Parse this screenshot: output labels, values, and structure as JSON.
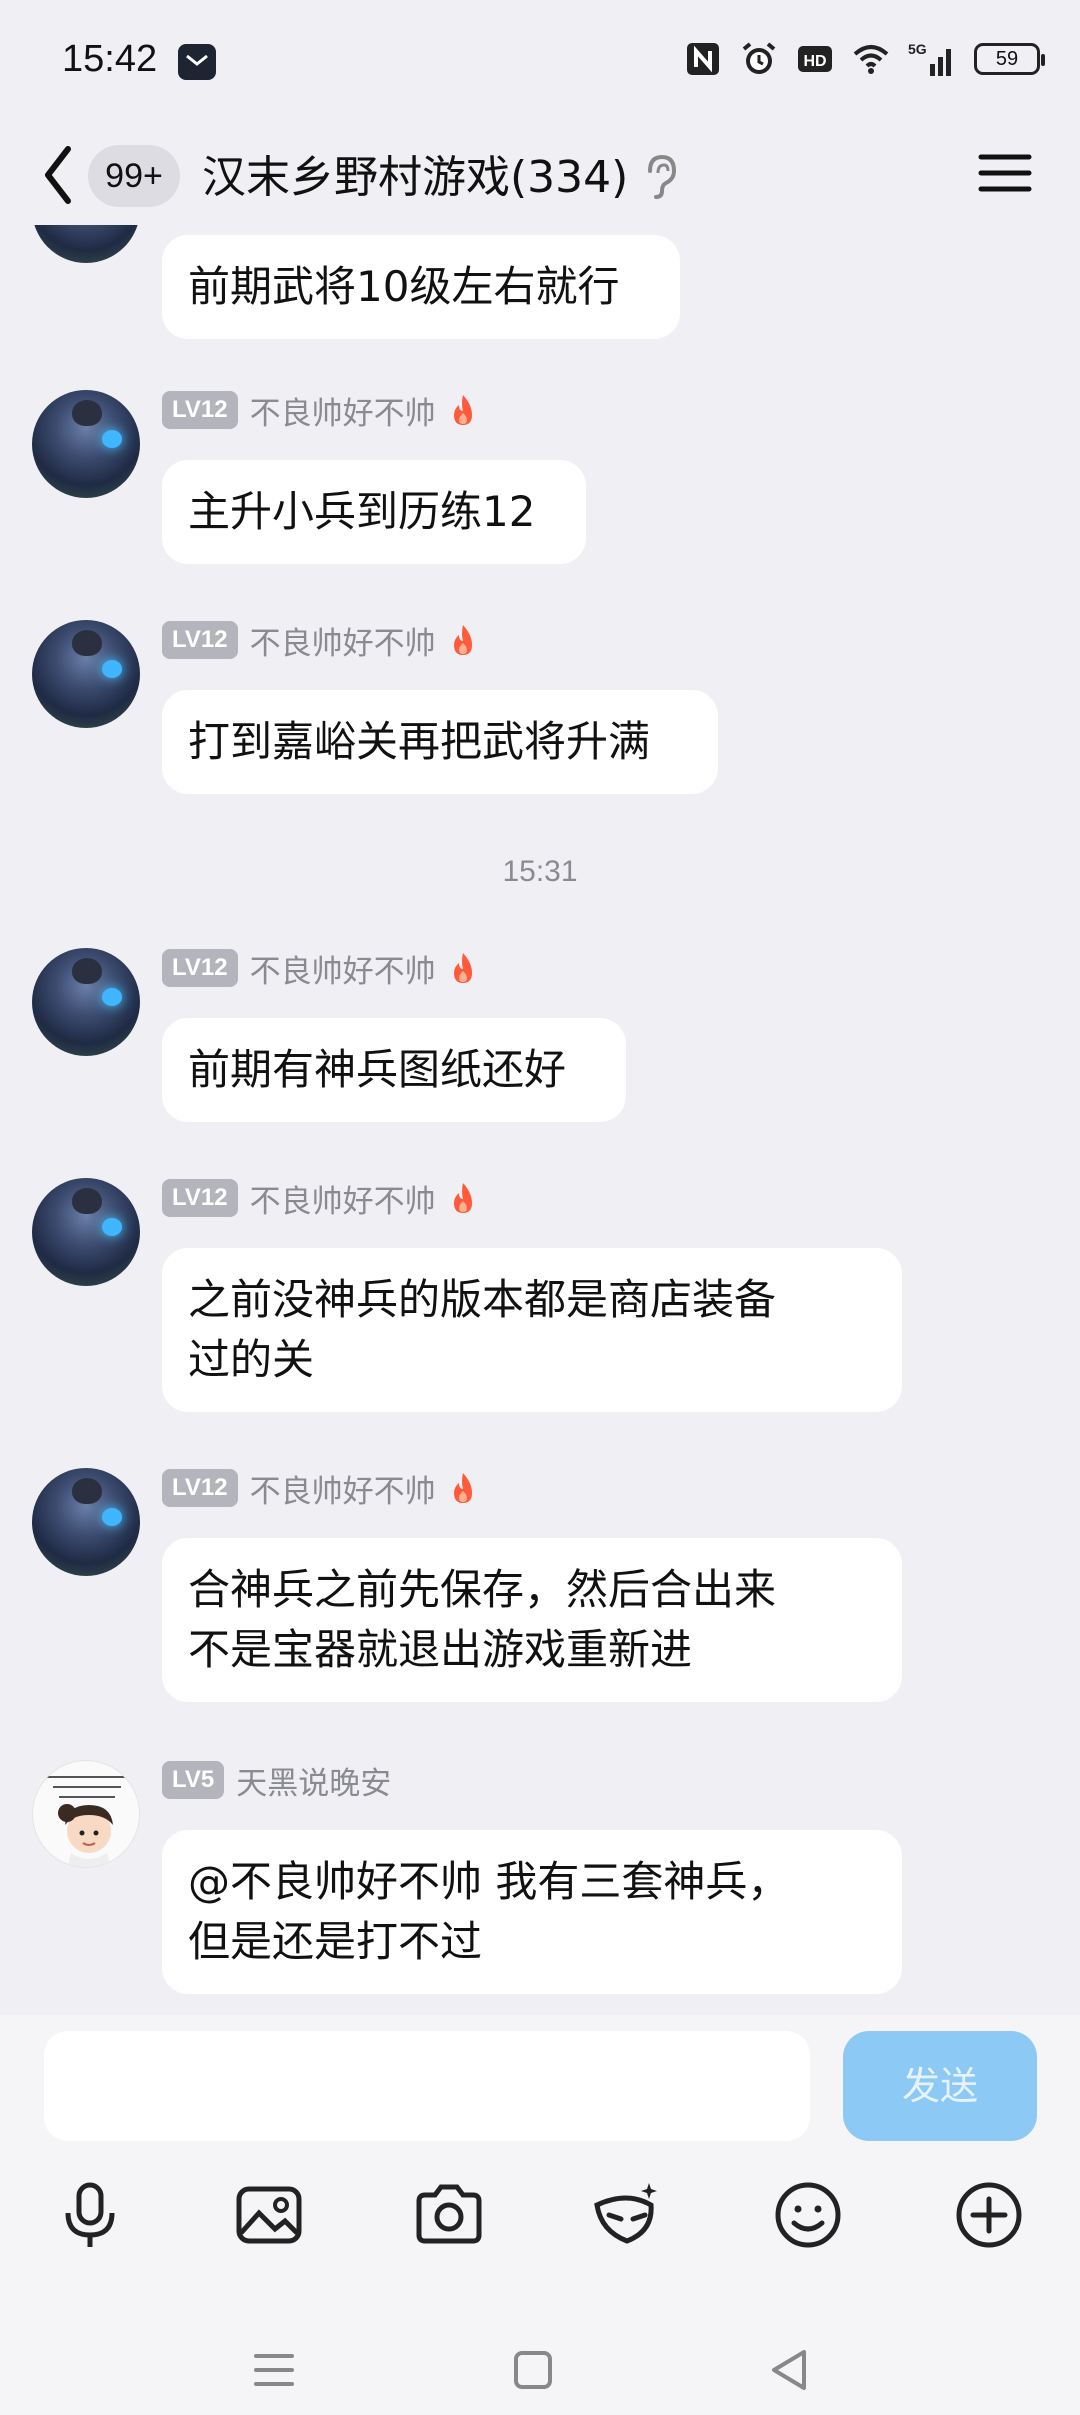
{
  "status_bar": {
    "time": "15:42",
    "battery": "59",
    "icons": [
      "notification-icon",
      "nfc-icon",
      "alarm-icon",
      "hd-icon",
      "wifi-icon",
      "5g-signal-icon",
      "battery-icon"
    ]
  },
  "header": {
    "unread_badge": "99+",
    "title": "汉末乡野村游戏(334)",
    "icons": [
      "back-icon",
      "ear-icon",
      "menu-icon"
    ]
  },
  "messages": [
    {
      "sender": "",
      "level": "",
      "text": "前期武将10级左右就行"
    },
    {
      "sender": "不良帅好不帅",
      "level": "LV12",
      "text": "主升小兵到历练12"
    },
    {
      "sender": "不良帅好不帅",
      "level": "LV12",
      "text": "打到嘉峪关再把武将升满"
    },
    {
      "sender": "不良帅好不帅",
      "level": "LV12",
      "text": "前期有神兵图纸还好"
    },
    {
      "sender": "不良帅好不帅",
      "level": "LV12",
      "text": "之前没神兵的版本都是商店装备\n过的关"
    },
    {
      "sender": "不良帅好不帅",
      "level": "LV12",
      "text": "合神兵之前先保存，然后合出来\n不是宝器就退出游戏重新进"
    },
    {
      "sender": "天黑说晚安",
      "level": "LV5",
      "text": "@不良帅好不帅 我有三套神兵，\n但是还是打不过"
    }
  ],
  "timestamp": "15:31",
  "input": {
    "placeholder": "",
    "send_label": "发送"
  },
  "toolbar_icons": [
    "microphone-icon",
    "image-icon",
    "camera-icon",
    "mask-icon",
    "emoji-icon",
    "plus-icon"
  ],
  "nav_icons": [
    "recent-apps-icon",
    "home-icon",
    "back-nav-icon"
  ],
  "colors": {
    "background": "#f0f0f4",
    "send_button": "#8ccaf5",
    "level_badge": "#b4b4bc",
    "flame": "#ff5a3c"
  }
}
